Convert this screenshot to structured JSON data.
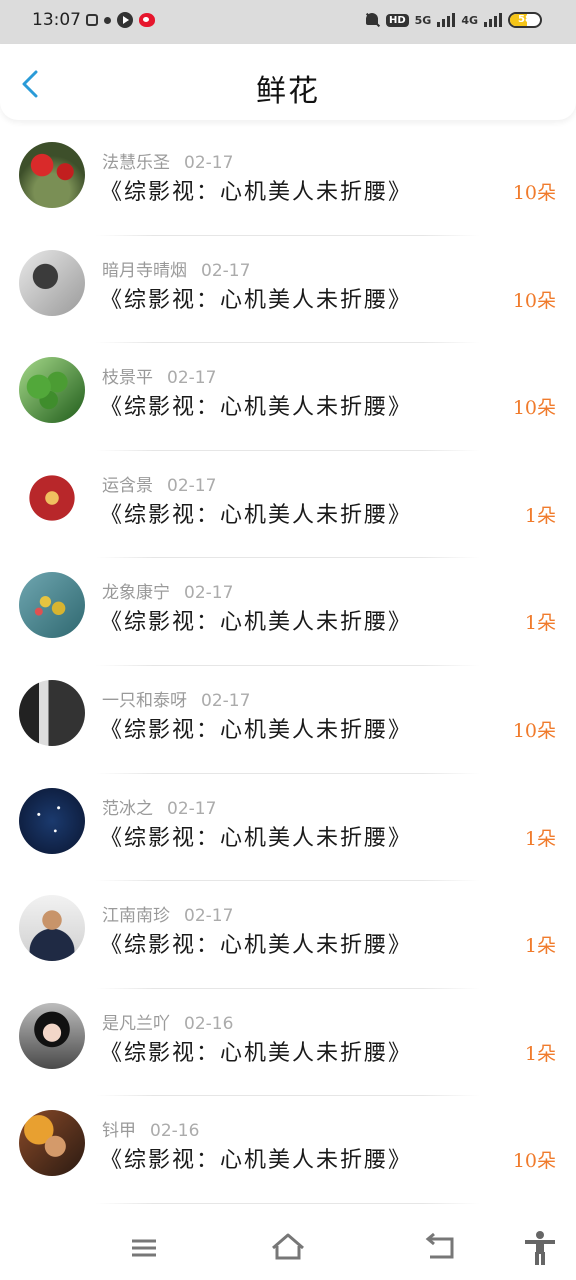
{
  "status": {
    "time": "13:07",
    "net1": "5G",
    "net2": "4G",
    "battery": "58",
    "battery_level_percent": 58
  },
  "header": {
    "title": "鲜花"
  },
  "rows": [
    {
      "name": "法慧乐圣",
      "date": "02-17",
      "book": "《综影视：心机美人未折腰》",
      "count": "10朵",
      "avatar": "avatar-red-flower"
    },
    {
      "name": "暗月寺晴烟",
      "date": "02-17",
      "book": "《综影视：心机美人未折腰》",
      "count": "10朵",
      "avatar": "avatar-gray-person"
    },
    {
      "name": "枝景平",
      "date": "02-17",
      "book": "《综影视：心机美人未折腰》",
      "count": "10朵",
      "avatar": "avatar-green-clover"
    },
    {
      "name": "运含景",
      "date": "02-17",
      "book": "《综影视：心机美人未折腰》",
      "count": "1朵",
      "avatar": "avatar-red-emblem"
    },
    {
      "name": "龙象康宁",
      "date": "02-17",
      "book": "《综影视：心机美人未折腰》",
      "count": "1朵",
      "avatar": "avatar-yellow-flowers"
    },
    {
      "name": "一只和泰呀",
      "date": "02-17",
      "book": "《综影视：心机美人未折腰》",
      "count": "10朵",
      "avatar": "avatar-bw-photo"
    },
    {
      "name": "范冰之",
      "date": "02-17",
      "book": "《综影视：心机美人未折腰》",
      "count": "1朵",
      "avatar": "avatar-constellation"
    },
    {
      "name": "江南南珍",
      "date": "02-17",
      "book": "《综影视：心机美人未折腰》",
      "count": "1朵",
      "avatar": "avatar-man-photo"
    },
    {
      "name": "是凡兰吖",
      "date": "02-16",
      "book": "《综影视：心机美人未折腰》",
      "count": "1朵",
      "avatar": "avatar-girl-photo"
    },
    {
      "name": "钭甲",
      "date": "02-16",
      "book": "《综影视：心机美人未折腰》",
      "count": "10朵",
      "avatar": "avatar-anime-art"
    }
  ],
  "nav": {
    "icons": [
      "menu-icon",
      "home-icon",
      "back-arrow-icon",
      "accessibility-icon"
    ]
  }
}
